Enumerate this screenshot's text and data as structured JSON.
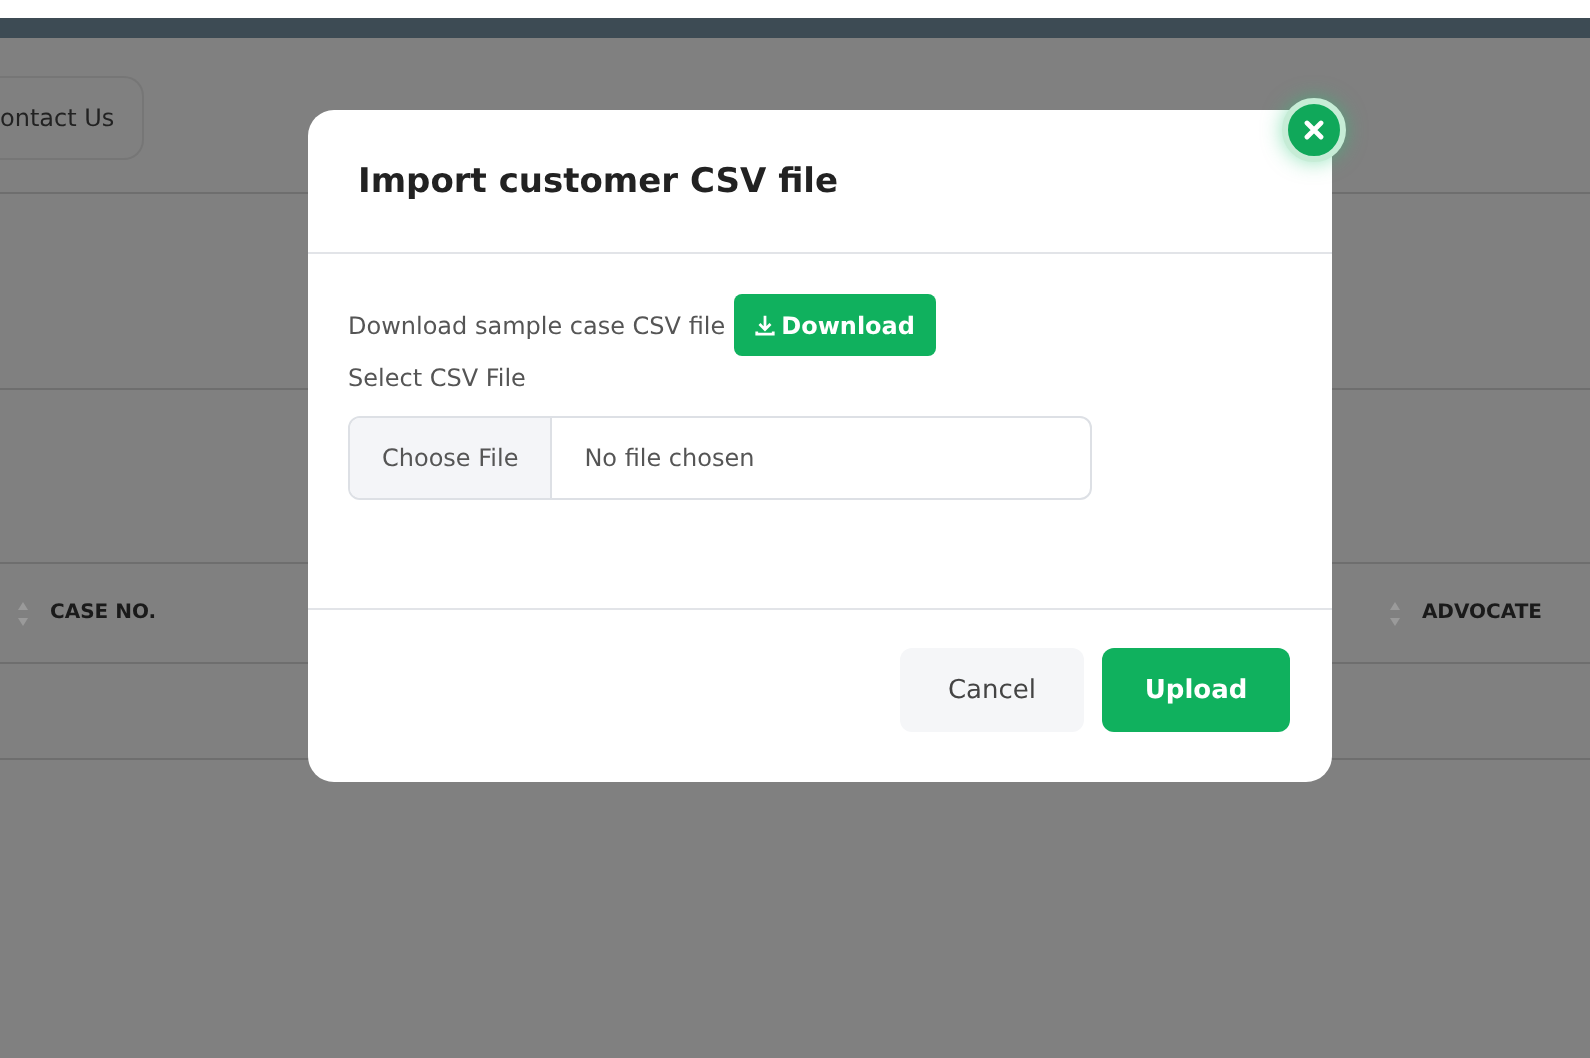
{
  "background_page": {
    "contact_button": "ontact Us",
    "table": {
      "columns": [
        {
          "label": "CASE NO."
        },
        {
          "label": "ADVOCATE"
        }
      ]
    }
  },
  "dialog": {
    "title": "Import customer CSV file",
    "sample_text": "Download sample case CSV file",
    "download_button": "Download",
    "file_label": "Select CSV File",
    "file_input": {
      "button": "Choose File",
      "status": "No file chosen"
    },
    "buttons": [
      {
        "label": "Cancel",
        "kind": "secondary"
      },
      {
        "label": "Upload",
        "kind": "primary"
      }
    ]
  }
}
